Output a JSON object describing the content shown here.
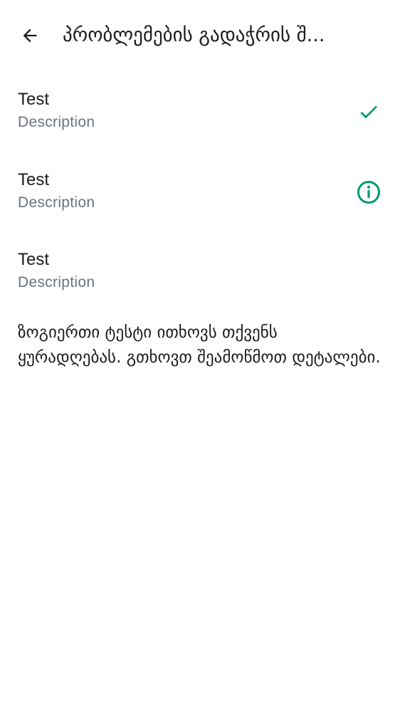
{
  "header": {
    "back_icon": "arrow-back-icon",
    "title": "პრობლემების გადაჭრის შ..."
  },
  "tests": [
    {
      "name": "Test",
      "description": "Description",
      "status": "passed",
      "icon": "check-icon"
    },
    {
      "name": "Test",
      "description": "Description",
      "status": "warning",
      "icon": "info-icon"
    },
    {
      "name": "Test",
      "description": "Description",
      "status": "none",
      "icon": ""
    }
  ],
  "notice": "ზოგიერთი ტესტი ითხოვს თქვენს ყურადღებას. გთხოვთ შეამოწმოთ დეტალები.",
  "colors": {
    "accent": "#009873",
    "text_primary": "#1c1b1f",
    "text_secondary": "#6b7380"
  }
}
